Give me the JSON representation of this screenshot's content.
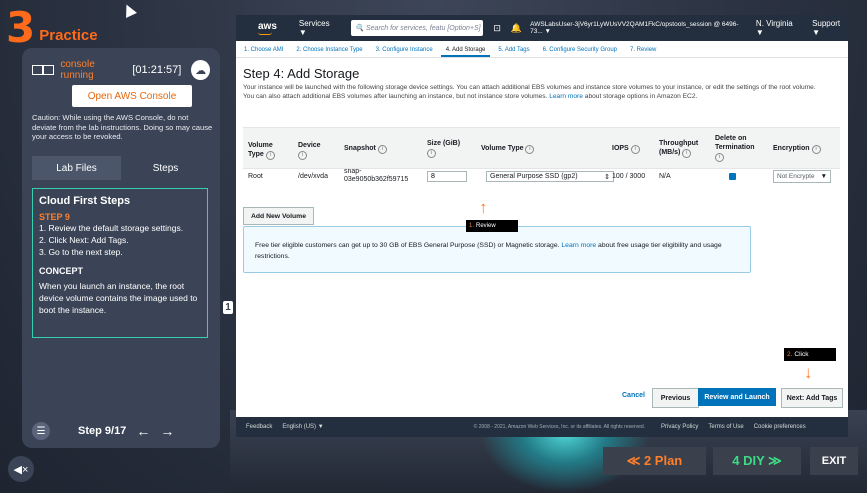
{
  "brand": {
    "number": "3",
    "label": "Practice"
  },
  "console": {
    "status": "console running",
    "timer": "[01:21:57]",
    "open_label": "Open AWS Console"
  },
  "caution": "Caution: While using the AWS Console, do not deviate from the lab instructions. Doing so may cause your access to be revoked.",
  "panel_tabs": [
    {
      "label": "Lab Files"
    },
    {
      "label": "Steps"
    }
  ],
  "steps": {
    "title": "Cloud First Steps",
    "step_label": "STEP 9",
    "lines": [
      "1. Review the default storage settings.",
      "2. Click Next: Add Tags.",
      "3. Go to the next step."
    ],
    "concept_title": "CONCEPT",
    "concept_text": "When you launch an instance, the root device volume contains the image used to boot the instance.",
    "marker": "1"
  },
  "nav": {
    "step_count": "Step 9/17",
    "prev_icon": "←",
    "next_icon": "→"
  },
  "bottom": {
    "plan_label": "≪ 2 Plan",
    "diy_label": "4 DIY ≫",
    "exit_label": "EXIT"
  },
  "aws": {
    "logo": "aws",
    "services": "Services ▼",
    "search_placeholder": "Search for services, featu [Option+S]",
    "account": "AWSLabsUser-3jV6yr1LyWUsVV2QAM1FkC/opstools_session @ 6496-73... ▼",
    "region": "N. Virginia ▼",
    "support": "Support ▼",
    "wizard_steps": [
      "1. Choose AMI",
      "2. Choose Instance Type",
      "3. Configure Instance",
      "4. Add Storage",
      "5. Add Tags",
      "6. Configure Security Group",
      "7. Review"
    ],
    "heading": "Step 4: Add Storage",
    "description": "Your instance will be launched with the following storage device settings. You can attach additional EBS volumes and instance store volumes to your instance, or edit the settings of the root volume. You can also attach additional EBS volumes after launching an instance, but not instance store volumes.",
    "learn_more": "Learn more",
    "description_tail": "about storage options in Amazon EC2.",
    "columns": {
      "volume_type": "Volume Type",
      "device": "Device",
      "snapshot": "Snapshot",
      "size": "Size (GiB)",
      "vol_type": "Volume Type",
      "iops": "IOPS",
      "throughput": "Throughput (MB/s)",
      "delete": "Delete on Termination",
      "encryption": "Encryption"
    },
    "row": {
      "volume_type": "Root",
      "device": "/dev/xvda",
      "snapshot": "snap-03e9050b362f59715",
      "size": "8",
      "vol_type": "General Purpose SSD (gp2)",
      "iops": "100 / 3000",
      "throughput": "N/A",
      "delete_checked": true,
      "encryption": "Not Encrypte"
    },
    "add_volume": "Add New Volume",
    "free_tier_1": "Free tier eligible customers can get up to 30 GB of EBS General Purpose (SSD) or Magnetic storage.",
    "free_tier_learn": "Learn more",
    "free_tier_2": "about free usage tier eligibility and usage restrictions.",
    "buttons": {
      "cancel": "Cancel",
      "previous": "Previous",
      "review_launch": "Review and Launch",
      "next": "Next: Add Tags"
    },
    "footer": {
      "feedback": "Feedback",
      "language": "English (US) ▼",
      "copyright": "© 2008 - 2021, Amazon Web Services, Inc. or its affiliates. All rights reserved.",
      "privacy": "Privacy Policy",
      "terms": "Terms of Use",
      "cookies": "Cookie preferences"
    }
  },
  "callouts": {
    "review": {
      "num": "1.",
      "text": "Review"
    },
    "click": {
      "num": "2.",
      "text": "Click"
    }
  },
  "colors": {
    "accent_orange": "#ff7f2a",
    "teal": "#35d0b0",
    "aws_blue": "#0073bb",
    "aws_navy": "#232f3e"
  }
}
